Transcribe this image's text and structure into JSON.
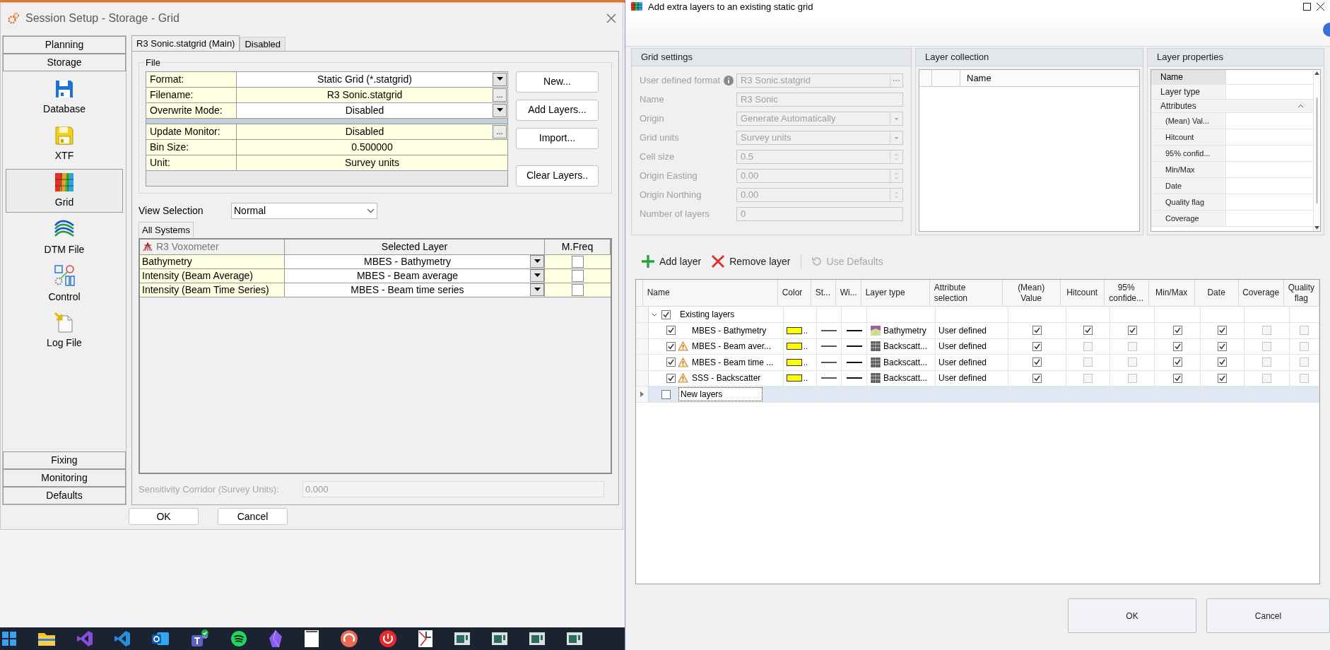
{
  "session_dialog": {
    "title": "Session Setup - Storage -  Grid",
    "sidebar": {
      "sections_top": [
        "Planning",
        "Storage"
      ],
      "items": [
        {
          "label": "Database",
          "selected": false
        },
        {
          "label": "XTF",
          "selected": false
        },
        {
          "label": "Grid",
          "selected": true
        },
        {
          "label": "DTM File",
          "selected": false
        },
        {
          "label": "Control",
          "selected": false
        },
        {
          "label": "Log File",
          "selected": false
        }
      ],
      "sections_bottom": [
        "Fixing",
        "Monitoring",
        "Defaults"
      ]
    },
    "tabs": [
      {
        "label": "R3 Sonic.statgrid (Main)",
        "selected": true
      },
      {
        "label": "Disabled",
        "selected": false
      }
    ],
    "file_group": {
      "title": "File",
      "properties": [
        {
          "kind": "dropdown",
          "label": "Format:",
          "value": "Static Grid (*.statgrid)"
        },
        {
          "kind": "browse",
          "label": "Filename:",
          "value": "R3 Sonic.statgrid",
          "button": "..."
        },
        {
          "kind": "dropdown",
          "label": "Overwrite Mode:",
          "value": "Disabled"
        },
        {
          "kind": "separator"
        },
        {
          "kind": "browse",
          "label": "Update Monitor:",
          "value": "Disabled",
          "button": "..."
        },
        {
          "kind": "plain",
          "label": "Bin Size:",
          "value": "0.500000"
        },
        {
          "kind": "plain",
          "label": "Unit:",
          "value": "Survey units"
        }
      ],
      "buttons": [
        "New...",
        "Add Layers...",
        "Import...",
        "Clear Layers.."
      ]
    },
    "view_selection": {
      "label": "View Selection",
      "value": "Normal"
    },
    "system_tabs": [
      {
        "label": "All Systems",
        "selected": true
      }
    ],
    "systems_table": {
      "columns": [
        "R3 Voxometer",
        "Selected Layer",
        "M.Freq"
      ],
      "rows": [
        {
          "name": "Bathymetry",
          "layer": "MBES - Bathymetry",
          "m_freq": false
        },
        {
          "name": "Intensity (Beam Average)",
          "layer": "MBES - Beam average",
          "m_freq": false
        },
        {
          "name": "Intensity (Beam Time Series)",
          "layer": "MBES - Beam time series",
          "m_freq": false
        }
      ]
    },
    "sensitivity_corridor": {
      "label": "Sensitivity Corridor (Survey Units):",
      "value": "0.000",
      "disabled": true
    },
    "footer_buttons": [
      "OK",
      "Cancel"
    ]
  },
  "layers_dialog": {
    "title": "Add extra layers to an existing static grid",
    "grid_settings": {
      "title": "Grid settings",
      "fields": [
        {
          "kind": "browse",
          "label": "User defined format",
          "value": "R3 Sonic.statgrid",
          "info": true
        },
        {
          "kind": "text",
          "label": "Name",
          "value": "R3 Sonic"
        },
        {
          "kind": "dropdown",
          "label": "Origin",
          "value": "Generate Automatically"
        },
        {
          "kind": "dropdown",
          "label": "Grid units",
          "value": "Survey units"
        },
        {
          "kind": "spinner",
          "label": "Cell size",
          "value": "0.5"
        },
        {
          "kind": "spinner",
          "label": "Origin Easting",
          "value": "0.00"
        },
        {
          "kind": "spinner",
          "label": "Origin Northing",
          "value": "0.00"
        },
        {
          "kind": "text",
          "label": "Number of layers",
          "value": "0"
        }
      ]
    },
    "layer_collection": {
      "title": "Layer collection",
      "columns": [
        "Name"
      ]
    },
    "layer_properties": {
      "title": "Layer properties",
      "rows": [
        {
          "kind": "field",
          "label": "Name",
          "selected": true
        },
        {
          "kind": "field",
          "label": "Layer type",
          "selected": false
        },
        {
          "kind": "group",
          "label": "Attributes",
          "selected": false,
          "expanded": true
        },
        {
          "kind": "sub",
          "label": "(Mean) Val...",
          "selected": false
        },
        {
          "kind": "sub",
          "label": "Hitcount",
          "selected": false
        },
        {
          "kind": "sub",
          "label": "95% confid...",
          "selected": false
        },
        {
          "kind": "sub",
          "label": "Min/Max",
          "selected": false
        },
        {
          "kind": "sub",
          "label": "Date",
          "selected": false
        },
        {
          "kind": "sub",
          "label": "Quality flag",
          "selected": false
        },
        {
          "kind": "sub",
          "label": "Coverage",
          "selected": false
        }
      ]
    },
    "toolbar": [
      {
        "kind": "add",
        "label": "Add layer",
        "disabled": false
      },
      {
        "kind": "remove",
        "label": "Remove layer",
        "disabled": false
      },
      {
        "kind": "reset",
        "label": "Use Defaults",
        "disabled": true
      }
    ],
    "layers_table": {
      "columns": [
        "Name",
        "Color",
        "St...",
        "Wi...",
        "Layer type",
        "Attribute selection",
        "(Mean) Value",
        "Hitcount",
        "95% confide...",
        "Min/Max",
        "Date",
        "Coverage",
        "Quality flag"
      ],
      "groups": [
        {
          "name": "Existing layers",
          "checked": true,
          "expanded": true,
          "selected": false,
          "children": [
            {
              "name": "MBES - Bathymetry",
              "checked": true,
              "warning": false,
              "color": "#ffff00",
              "color_text": "..",
              "kind": "bathymetry",
              "layer_type": "Bathymetry",
              "attribute_selection": "User defined",
              "attributes": [
                true,
                true,
                true,
                true,
                true,
                false,
                false
              ]
            },
            {
              "name": "MBES - Beam aver...",
              "checked": true,
              "warning": true,
              "color": "#ffff00",
              "color_text": "..",
              "kind": "backscatter",
              "layer_type": "Backscatt...",
              "attribute_selection": "User defined",
              "attributes": [
                true,
                false,
                false,
                true,
                true,
                false,
                false
              ]
            },
            {
              "name": "MBES - Beam time ...",
              "checked": true,
              "warning": true,
              "color": "#ffff00",
              "color_text": "..",
              "kind": "backscatter",
              "layer_type": "Backscatt...",
              "attribute_selection": "User defined",
              "attributes": [
                true,
                false,
                false,
                true,
                true,
                false,
                false
              ]
            },
            {
              "name": "SSS - Backscatter",
              "checked": true,
              "warning": true,
              "color": "#ffff00",
              "color_text": "..",
              "kind": "backscatter",
              "layer_type": "Backscatt...",
              "attribute_selection": "User defined",
              "attributes": [
                true,
                false,
                false,
                true,
                true,
                false,
                false
              ]
            }
          ]
        },
        {
          "name": "New layers",
          "checked": false,
          "selected": true
        }
      ]
    },
    "buttons": [
      "OK",
      "Cancel"
    ]
  }
}
